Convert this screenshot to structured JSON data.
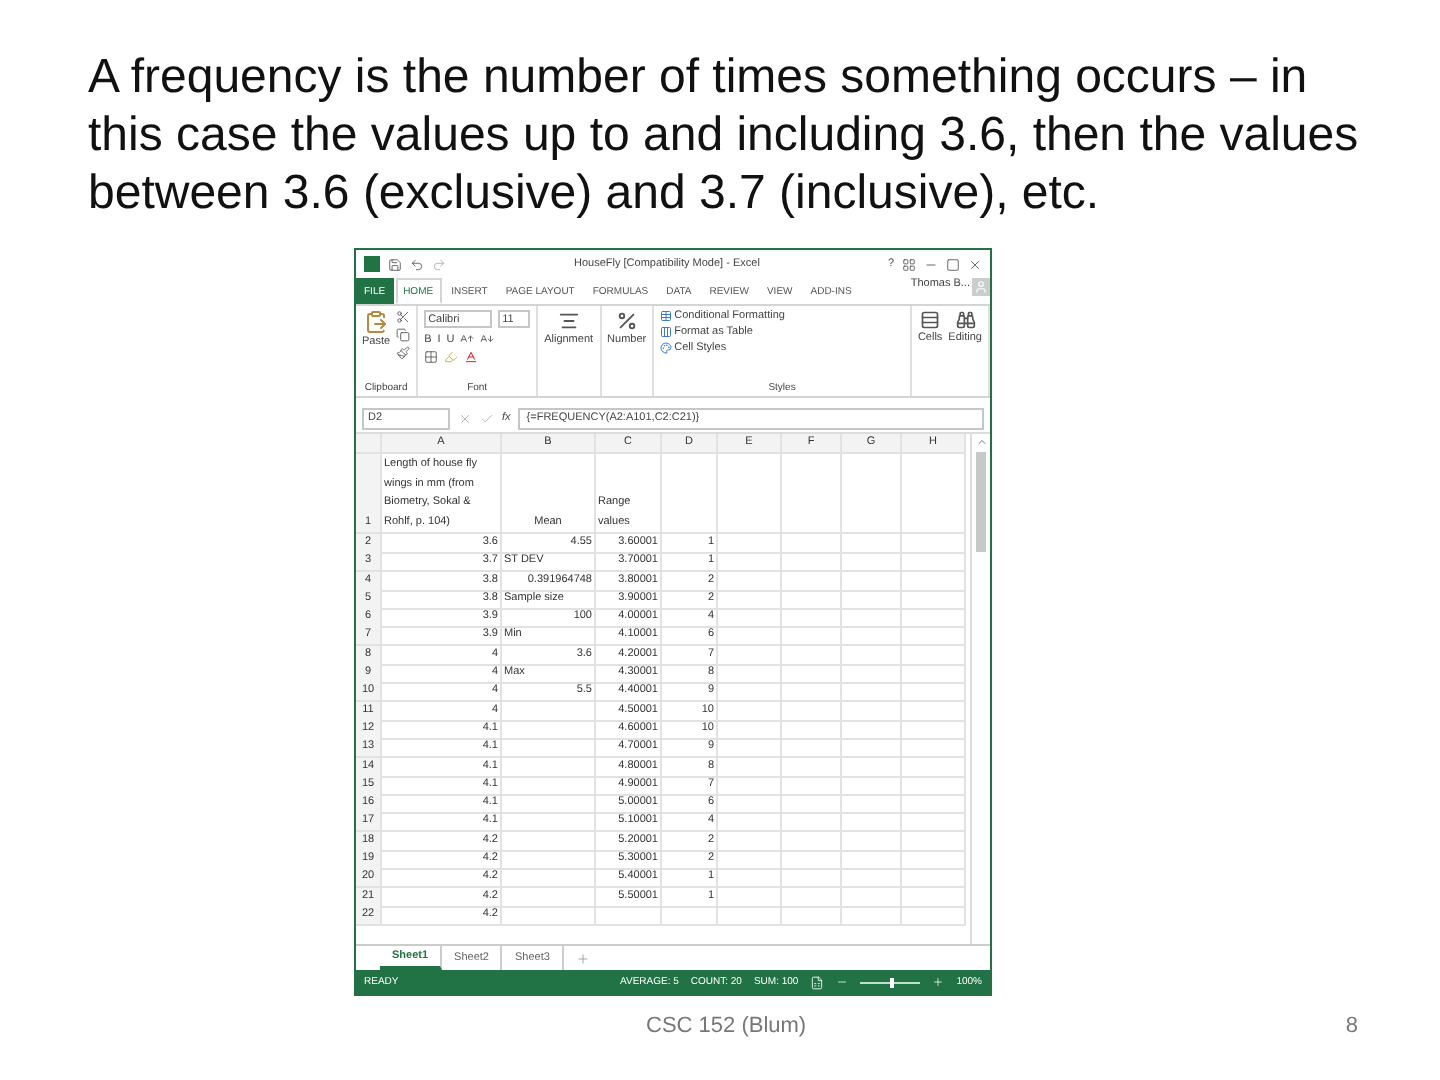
{
  "heading": "A frequency is the number of times something occurs – in this case the values up to and including 3.6, then the values between 3.6 (exclusive) and 3.7 (inclusive), etc.",
  "excel": {
    "title": "HouseFly [Compatibility Mode] - Excel",
    "help": "?",
    "tabs": [
      {
        "label": "FILE",
        "selected": false,
        "kind": "file"
      },
      {
        "label": "HOME",
        "selected": true,
        "kind": "tab"
      },
      {
        "label": "INSERT",
        "selected": false,
        "kind": "tab"
      },
      {
        "label": "PAGE LAYOUT",
        "selected": false,
        "kind": "tab"
      },
      {
        "label": "FORMULAS",
        "selected": false,
        "kind": "tab"
      },
      {
        "label": "DATA",
        "selected": false,
        "kind": "tab"
      },
      {
        "label": "REVIEW",
        "selected": false,
        "kind": "tab"
      },
      {
        "label": "VIEW",
        "selected": false,
        "kind": "tab"
      },
      {
        "label": "ADD-INS",
        "selected": false,
        "kind": "tab"
      }
    ],
    "user": "Thomas B...",
    "ribbon": {
      "paste": "Paste",
      "clipboard_label": "Clipboard",
      "font_name": "Calibri",
      "font_size": "11",
      "font_styles": [
        "B",
        "I",
        "U"
      ],
      "font_label": "Font",
      "alignment": "Alignment",
      "number": "Number",
      "styles": [
        "Conditional Formatting",
        "Format as Table",
        "Cell Styles"
      ],
      "styles_label": "Styles",
      "cells": "Cells",
      "editing": "Editing"
    },
    "formula_bar": {
      "name_box": "D2",
      "fx": "fx",
      "formula": "{=FREQUENCY(A2:A101,C2:C21)}"
    },
    "columns": [
      "A",
      "B",
      "C",
      "D",
      "E",
      "F",
      "G",
      "H"
    ],
    "header_row": {
      "number": "1",
      "a": "Length of house fly wings in mm (from Biometry, Sokal & Rohlf, p. 104)",
      "b": "Mean",
      "c": "Range values"
    },
    "rows": [
      {
        "number": "2",
        "a": "3.6",
        "b": {
          "text": "4.55",
          "kind": "number"
        },
        "c": "3.60001",
        "d": "1"
      },
      {
        "number": "3",
        "a": "3.7",
        "b": {
          "text": "ST DEV",
          "kind": "label"
        },
        "c": "3.70001",
        "d": "1"
      },
      {
        "number": "4",
        "a": "3.8",
        "b": {
          "text": "0.391964748",
          "kind": "number"
        },
        "c": "3.80001",
        "d": "2"
      },
      {
        "number": "5",
        "a": "3.8",
        "b": {
          "text": "Sample size",
          "kind": "label"
        },
        "c": "3.90001",
        "d": "2"
      },
      {
        "number": "6",
        "a": "3.9",
        "b": {
          "text": "100",
          "kind": "number"
        },
        "c": "4.00001",
        "d": "4"
      },
      {
        "number": "7",
        "a": "3.9",
        "b": {
          "text": "Min",
          "kind": "label"
        },
        "c": "4.10001",
        "d": "6"
      },
      {
        "number": "8",
        "a": "4",
        "b": {
          "text": "3.6",
          "kind": "number"
        },
        "c": "4.20001",
        "d": "7"
      },
      {
        "number": "9",
        "a": "4",
        "b": {
          "text": "Max",
          "kind": "label"
        },
        "c": "4.30001",
        "d": "8"
      },
      {
        "number": "10",
        "a": "4",
        "b": {
          "text": "5.5",
          "kind": "number"
        },
        "c": "4.40001",
        "d": "9"
      },
      {
        "number": "11",
        "a": "4",
        "c": "4.50001",
        "d": "10"
      },
      {
        "number": "12",
        "a": "4.1",
        "c": "4.60001",
        "d": "10"
      },
      {
        "number": "13",
        "a": "4.1",
        "c": "4.70001",
        "d": "9"
      },
      {
        "number": "14",
        "a": "4.1",
        "c": "4.80001",
        "d": "8"
      },
      {
        "number": "15",
        "a": "4.1",
        "c": "4.90001",
        "d": "7"
      },
      {
        "number": "16",
        "a": "4.1",
        "c": "5.00001",
        "d": "6"
      },
      {
        "number": "17",
        "a": "4.1",
        "c": "5.10001",
        "d": "4"
      },
      {
        "number": "18",
        "a": "4.2",
        "c": "5.20001",
        "d": "2"
      },
      {
        "number": "19",
        "a": "4.2",
        "c": "5.30001",
        "d": "2"
      },
      {
        "number": "20",
        "a": "4.2",
        "c": "5.40001",
        "d": "1"
      },
      {
        "number": "21",
        "a": "4.2",
        "c": "5.50001",
        "d": "1"
      },
      {
        "number": "22",
        "a": "4.2"
      }
    ],
    "sheets": [
      {
        "label": "Sheet1",
        "selected": true
      },
      {
        "label": "Sheet2",
        "selected": false
      },
      {
        "label": "Sheet3",
        "selected": false
      }
    ],
    "status": {
      "mode": "READY",
      "items": [
        "AVERAGE: 5",
        "COUNT: 20",
        "SUM: 100"
      ],
      "zoom": {
        "level": 0.5
      },
      "zoom_label": "100%"
    }
  },
  "footer": {
    "center": "CSC 152 (Blum)",
    "page": "8"
  }
}
